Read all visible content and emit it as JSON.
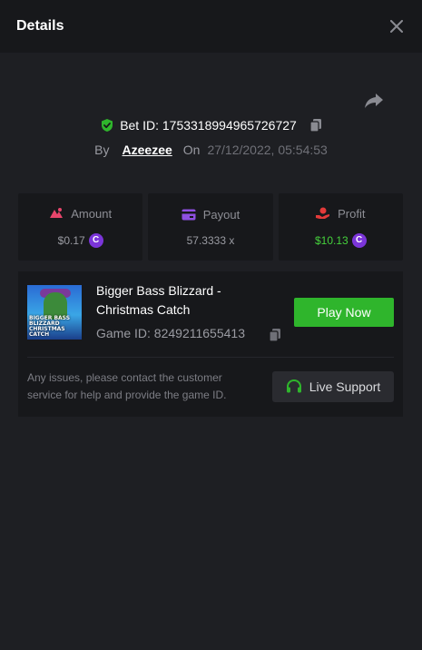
{
  "header": {
    "title": "Details"
  },
  "bet": {
    "id_label": "Bet ID: 1753318994965726727",
    "by_label": "By",
    "username": "Azeezee",
    "on_label": "On",
    "datetime": "27/12/2022, 05:54:53"
  },
  "stats": {
    "amount": {
      "label": "Amount",
      "value": "$0.17"
    },
    "payout": {
      "label": "Payout",
      "value": "57.3333 x"
    },
    "profit": {
      "label": "Profit",
      "value": "$10.13"
    }
  },
  "coin_glyph": "C",
  "game": {
    "thumbnail_text": "BIGGER BASS BLIZZARD CHRISTMAS CATCH",
    "name": "Bigger Bass Blizzard - Christmas Catch",
    "id_label": "Game ID: 8249211655413",
    "play_label": "Play Now",
    "support_text": "Any issues, please contact the customer service for help and provide the game ID.",
    "live_support_label": "Live Support"
  },
  "colors": {
    "accent_green": "#2fb52c",
    "profit_green": "#45d13c",
    "amount_icon": "#e8456b",
    "payout_icon": "#8e4fe0",
    "profit_icon": "#e33a3a",
    "coin": "#7b35d9"
  },
  "icons": {
    "close": "close-icon",
    "share": "share-icon",
    "verified": "shield-check-icon",
    "copy": "copy-icon",
    "amount": "amount-icon",
    "payout": "card-icon",
    "profit": "hand-coin-icon",
    "coin": "coin-icon",
    "headset": "headset-icon"
  }
}
